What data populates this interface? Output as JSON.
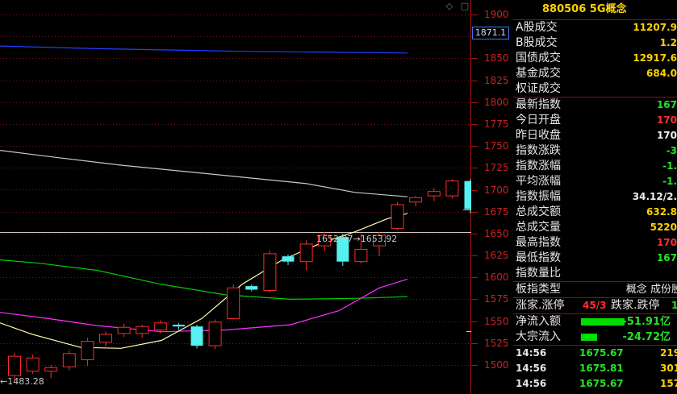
{
  "chart": {
    "price_labels": [
      "1900",
      "1875",
      "1850",
      "1825",
      "1800",
      "1775",
      "1750",
      "1725",
      "1700",
      "1675",
      "1650",
      "1625",
      "1600",
      "1575",
      "1550",
      "1525",
      "1500"
    ],
    "current_marker": "1871.1",
    "high_annotation": "1652.97→1653.92",
    "low_annotation": "←1483.28",
    "candles": [
      {
        "o": 1488,
        "c": 1510,
        "h": 1514,
        "l": 1483
      },
      {
        "o": 1493,
        "c": 1508,
        "h": 1512,
        "l": 1490
      },
      {
        "o": 1493,
        "c": 1497,
        "h": 1500,
        "l": 1485
      },
      {
        "o": 1498,
        "c": 1513,
        "h": 1517,
        "l": 1494
      },
      {
        "o": 1506,
        "c": 1527,
        "h": 1531,
        "l": 1499
      },
      {
        "o": 1526,
        "c": 1535,
        "h": 1538,
        "l": 1521
      },
      {
        "o": 1536,
        "c": 1543,
        "h": 1547,
        "l": 1532
      },
      {
        "o": 1536,
        "c": 1544,
        "h": 1546,
        "l": 1531
      },
      {
        "o": 1540,
        "c": 1548,
        "h": 1551,
        "l": 1536
      },
      {
        "o": 1546,
        "c": 1544,
        "h": 1548,
        "l": 1540
      },
      {
        "o": 1544,
        "c": 1522,
        "h": 1546,
        "l": 1519
      },
      {
        "o": 1522,
        "c": 1549,
        "h": 1552,
        "l": 1518
      },
      {
        "o": 1553,
        "c": 1588,
        "h": 1592,
        "l": 1552
      },
      {
        "o": 1590,
        "c": 1586,
        "h": 1592,
        "l": 1584
      },
      {
        "o": 1585,
        "c": 1627,
        "h": 1631,
        "l": 1583
      },
      {
        "o": 1624,
        "c": 1618,
        "h": 1626,
        "l": 1614
      },
      {
        "o": 1618,
        "c": 1638,
        "h": 1642,
        "l": 1608
      },
      {
        "o": 1636,
        "c": 1648,
        "h": 1652,
        "l": 1630
      },
      {
        "o": 1646,
        "c": 1618,
        "h": 1650,
        "l": 1613
      },
      {
        "o": 1618,
        "c": 1632,
        "h": 1650,
        "l": 1616
      },
      {
        "o": 1636,
        "c": 1648,
        "h": 1652,
        "l": 1624
      },
      {
        "o": 1656,
        "c": 1683,
        "h": 1686,
        "l": 1654
      },
      {
        "o": 1686,
        "c": 1691,
        "h": 1693,
        "l": 1681
      },
      {
        "o": 1693,
        "c": 1698,
        "h": 1702,
        "l": 1687
      },
      {
        "o": 1693,
        "c": 1710,
        "h": 1712,
        "l": 1690
      },
      {
        "o": 1710,
        "c": 1678,
        "h": 1712,
        "l": 1673
      }
    ],
    "colors": {
      "up": "#ff2a2a",
      "down": "#55f0f0",
      "grid": "#8a1010",
      "ma1": "#ffffb0",
      "ma2": "#ff30ff",
      "ma3": "#00d000",
      "ma4": "#c8c8c8",
      "ma5": "#2040ff"
    }
  },
  "panel": {
    "title": "880506 5G概念",
    "rows1": [
      {
        "label": "A股成交",
        "value": "11207.9",
        "cls": "y"
      },
      {
        "label": "B股成交",
        "value": "1.2",
        "cls": "y"
      },
      {
        "label": "国债成交",
        "value": "12917.6",
        "cls": "y"
      },
      {
        "label": "基金成交",
        "value": "684.0",
        "cls": "y"
      },
      {
        "label": "权证成交",
        "value": "",
        "cls": "y"
      }
    ],
    "rows2": [
      {
        "label": "最新指数",
        "value": "167",
        "cls": "g"
      },
      {
        "label": "今日开盘",
        "value": "170",
        "cls": "r"
      },
      {
        "label": "昨日收盘",
        "value": "170",
        "cls": "w"
      },
      {
        "label": "指数涨跌",
        "value": "-3",
        "cls": "g"
      },
      {
        "label": "指数涨幅",
        "value": "-1.",
        "cls": "g"
      },
      {
        "label": "平均涨幅",
        "value": "-1.",
        "cls": "g"
      },
      {
        "label": "指数振幅",
        "value": "34.12/2.",
        "cls": "w"
      },
      {
        "label": "总成交额",
        "value": "632.8",
        "cls": "y"
      },
      {
        "label": "总成交量",
        "value": "5220",
        "cls": "y"
      },
      {
        "label": "最高指数",
        "value": "170",
        "cls": "r"
      },
      {
        "label": "最低指数",
        "value": "167",
        "cls": "g"
      },
      {
        "label": "指数量比",
        "value": "",
        "cls": "w"
      }
    ],
    "type_label": "板指类型",
    "type_value": "概念 成份股",
    "adv_label": "涨家.涨停",
    "adv_value": "45/3",
    "dec_label": "跌家.跌停",
    "dec_value": "1",
    "flow1_label": "净流入额",
    "flow1_value": "-51.91亿",
    "flow2_label": "大宗流入",
    "flow2_value": "-24.72亿",
    "ticks": [
      {
        "time": "14:56",
        "price": "1675.67",
        "vol": "219"
      },
      {
        "time": "14:56",
        "price": "1675.81",
        "vol": "301"
      },
      {
        "time": "14:56",
        "price": "1675.67",
        "vol": "157"
      }
    ]
  }
}
